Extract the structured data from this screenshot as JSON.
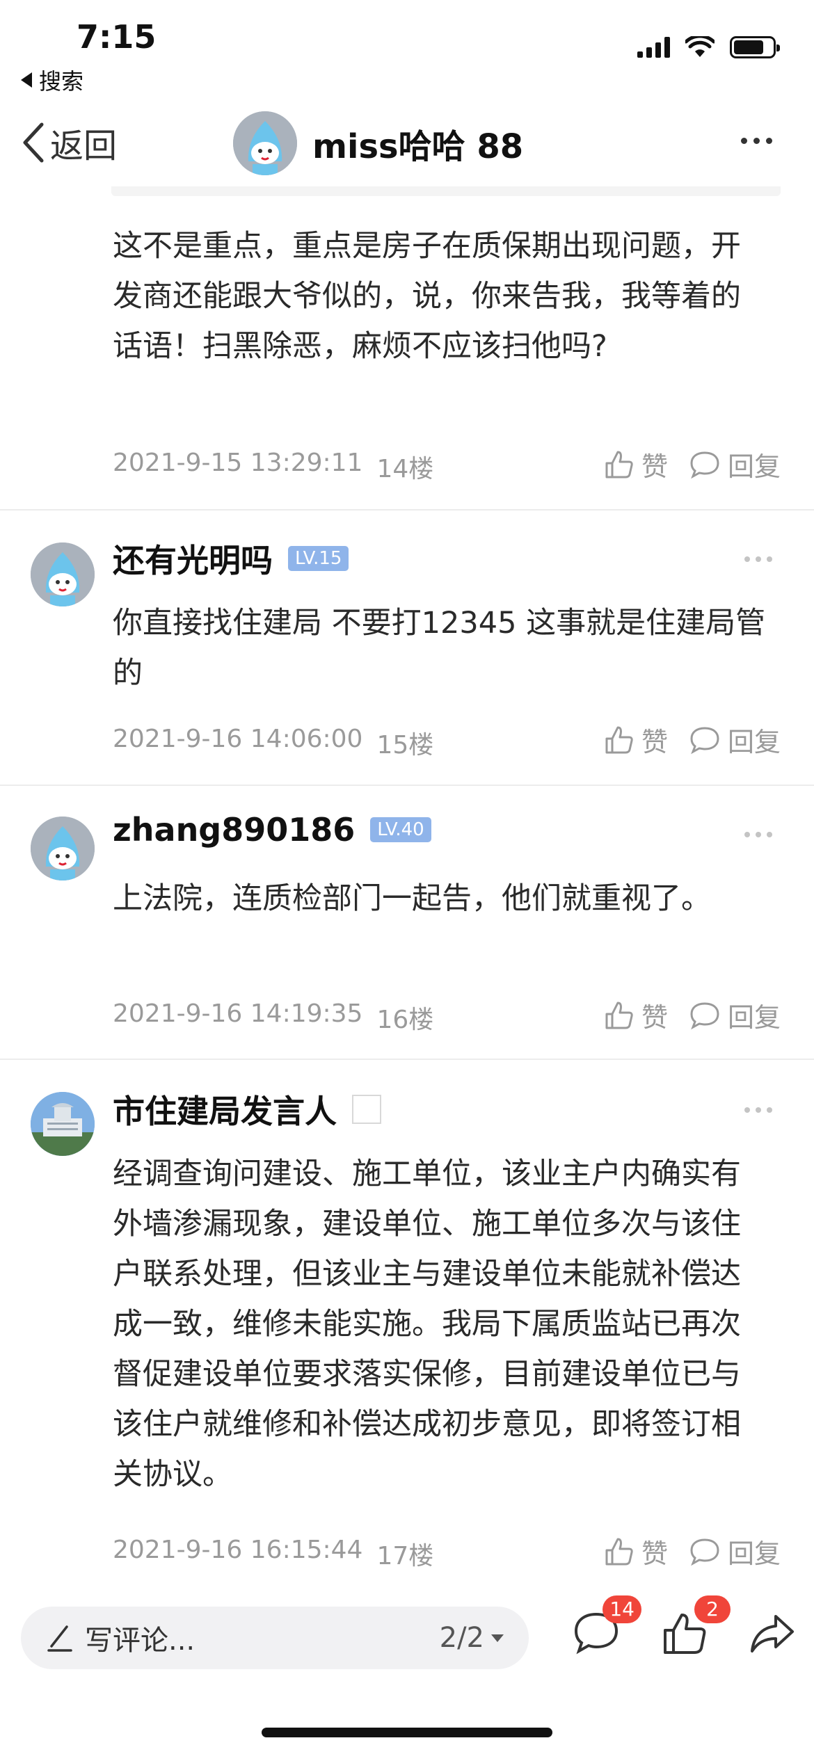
{
  "status_bar": {
    "time": "7:15",
    "back_app_label": "搜索"
  },
  "nav": {
    "back_label": "返回",
    "title": "miss哈哈 88"
  },
  "comments": [
    {
      "body": "这不是重点，重点是房子在质保期出现问题，开发商还能跟大爷似的，说，你来告我，我等着的话语！扫黑除恶，麻烦不应该扫他吗?",
      "time": "2021-9-15 13:29:11",
      "floor": "14楼",
      "like_label": "赞",
      "reply_label": "回复"
    },
    {
      "name": "还有光明吗",
      "level": "LV.15",
      "body": "你直接找住建局  不要打12345  这事就是住建局管的",
      "time": "2021-9-16 14:06:00",
      "floor": "15楼",
      "like_label": "赞",
      "reply_label": "回复"
    },
    {
      "name": "zhang890186",
      "level": "LV.40",
      "body": "上法院，连质检部门一起告，他们就重视了。",
      "time": "2021-9-16 14:19:35",
      "floor": "16楼",
      "like_label": "赞",
      "reply_label": "回复"
    },
    {
      "name": "市住建局发言人",
      "body": "经调查询问建设、施工单位，该业主户内确实有外墙渗漏现象，建设单位、施工单位多次与该住户联系处理，但该业主与建设单位未能就补偿达成一致，维修未能实施。我局下属质监站已再次督促建设单位要求落实保修，目前建设单位已与该住户就维修和补偿达成初步意见，即将签订相关协议。",
      "time": "2021-9-16 16:15:44",
      "floor": "17楼",
      "like_label": "赞",
      "reply_label": "回复"
    }
  ],
  "bottom_bar": {
    "input_placeholder": "写评论...",
    "page_indicator": "2/2",
    "comment_count": "14",
    "like_count": "2"
  },
  "colors": {
    "level_badge": "#8fb4ea",
    "count_badge": "#f0453a",
    "meta_text": "#9a9a9a"
  }
}
